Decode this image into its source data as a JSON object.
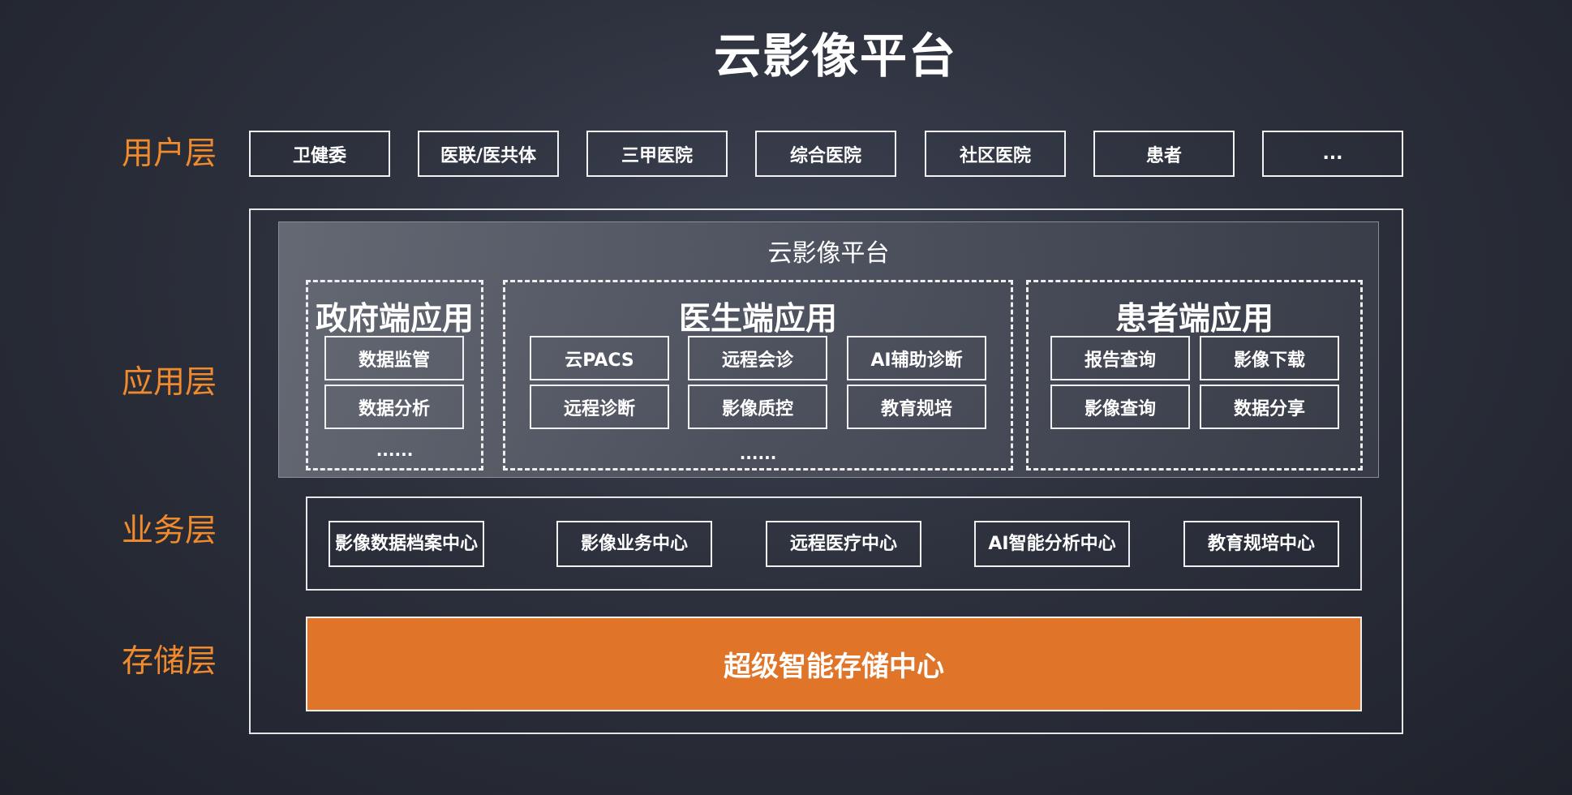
{
  "title": "云影像平台",
  "layers": {
    "user": "用户层",
    "app": "应用层",
    "business": "业务层",
    "storage": "存储层"
  },
  "user_layer": [
    "卫健委",
    "医联/医共体",
    "三甲医院",
    "综合医院",
    "社区医院",
    "患者",
    "..."
  ],
  "app_layer": {
    "panel_title": "云影像平台",
    "government": {
      "title": "政府端应用",
      "items": [
        "数据监管",
        "数据分析"
      ],
      "more": "......"
    },
    "doctor": {
      "title": "医生端应用",
      "items": [
        "云PACS",
        "远程会诊",
        "AI辅助诊断",
        "远程诊断",
        "影像质控",
        "教育规培"
      ],
      "more": "......"
    },
    "patient": {
      "title": "患者端应用",
      "items": [
        "报告查询",
        "影像下载",
        "影像查询",
        "数据分享"
      ]
    }
  },
  "business_layer": [
    "影像数据档案中心",
    "影像业务中心",
    "远程医疗中心",
    "AI智能分析中心",
    "教育规培中心"
  ],
  "storage_layer": "超级智能存储中心",
  "colors": {
    "accent": "#f08a2c",
    "storage_fill": "#e07428",
    "background": "#2c303c"
  }
}
